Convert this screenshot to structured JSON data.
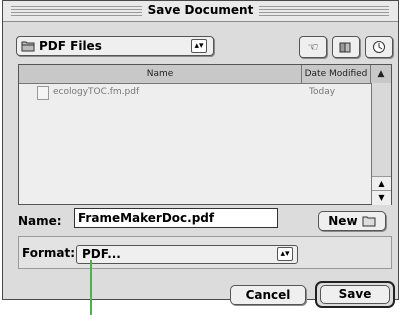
{
  "window": {
    "title": "Save Document"
  },
  "location_popup": {
    "value": "PDF Files"
  },
  "toolbar": {
    "nav_icons": [
      "pointer-icon",
      "folder-menu-icon",
      "recent-icon"
    ]
  },
  "file_list": {
    "columns": {
      "name": "Name",
      "date": "Date Modified"
    },
    "rows": [
      {
        "name": "ecologyTOC.fm.pdf",
        "date": "Today"
      }
    ]
  },
  "name_field": {
    "label": "Name:",
    "value": "FrameMakerDoc.pdf"
  },
  "new_button": {
    "label": "New"
  },
  "format": {
    "label": "Format:",
    "value": "PDF..."
  },
  "buttons": {
    "cancel": "Cancel",
    "save": "Save"
  },
  "colors": {
    "callout": "#4fb24f"
  }
}
